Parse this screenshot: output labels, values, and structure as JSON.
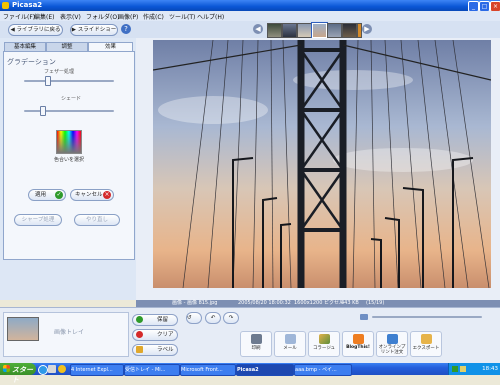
{
  "window": {
    "title": "Picasa2"
  },
  "menu": [
    "ファイル(F)",
    "編集(E)",
    "表示(V)",
    "フォルダ(O)",
    "画像(P)",
    "作成(C)",
    "ツール(T)",
    "ヘルプ(H)"
  ],
  "toolbar": {
    "library_button": "ライブラリに戻る",
    "slideshow_button": "スライドショー",
    "help_icon": "?"
  },
  "tabs": [
    "基本編集",
    "調整",
    "効果"
  ],
  "effects_panel": {
    "heading": "グラデーション",
    "slider1_label": "フェザー処理",
    "slider1_value": 0.25,
    "slider2_label": "シェード",
    "slider2_value": 0.2,
    "color_label": "色合いを選択",
    "apply_button": "適用",
    "cancel_button": "キャンセル",
    "disabled_left": "シャープ処理",
    "disabled_right": "やり直し"
  },
  "status": {
    "filename": "画像 - 画像 815.jpg",
    "date": "2005/08/20 18:00:32",
    "dimensions": "1600x1200 ピクセル",
    "size": "443 KB",
    "index": "(15/19)"
  },
  "tray": {
    "empty_label": "画像トレイ",
    "hold_button": "保留",
    "clear_button": "クリア",
    "label_button": "ラベル",
    "actions": [
      "印刷",
      "メール",
      "コラージュ",
      "BlogThis!",
      "オンラインプリント注文",
      "エクスポート"
    ]
  },
  "taskbar": {
    "start": "スタート",
    "tasks": [
      "4 Internet Expl...",
      "受信トレイ - Mi...",
      "Microsoft Front...",
      "Picasa2",
      "aaa.bmp - ペイ..."
    ],
    "clock": "18:43"
  },
  "colors": {
    "accent": "#2e5fbf",
    "apply_green": "#2f9a2a",
    "cancel_red": "#d42a2a"
  }
}
